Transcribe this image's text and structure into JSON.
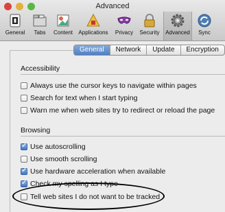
{
  "window": {
    "title": "Advanced",
    "traffic_colors": [
      "#d9453b",
      "#e5b13a",
      "#5bb744"
    ]
  },
  "toolbar": {
    "items": [
      {
        "label": "General",
        "icon": "general-icon"
      },
      {
        "label": "Tabs",
        "icon": "tabs-icon"
      },
      {
        "label": "Content",
        "icon": "content-icon"
      },
      {
        "label": "Applications",
        "icon": "applications-icon"
      },
      {
        "label": "Privacy",
        "icon": "privacy-icon"
      },
      {
        "label": "Security",
        "icon": "security-icon"
      },
      {
        "label": "Advanced",
        "icon": "gear-icon",
        "selected": true
      },
      {
        "label": "Sync",
        "icon": "sync-icon"
      }
    ]
  },
  "tabs": {
    "items": [
      {
        "label": "General",
        "active": true
      },
      {
        "label": "Network",
        "active": false
      },
      {
        "label": "Update",
        "active": false
      },
      {
        "label": "Encryption",
        "active": false
      }
    ]
  },
  "accessibility": {
    "title": "Accessibility",
    "options": [
      {
        "label": "Always use the cursor keys to navigate within pages",
        "checked": false
      },
      {
        "label": "Search for text when I start typing",
        "checked": false
      },
      {
        "label": "Warn me when web sites try to redirect or reload the page",
        "checked": false
      }
    ]
  },
  "browsing": {
    "title": "Browsing",
    "options": [
      {
        "label": "Use autoscrolling",
        "checked": true
      },
      {
        "label": "Use smooth scrolling",
        "checked": false
      },
      {
        "label": "Use hardware acceleration when available",
        "checked": true
      },
      {
        "label": "Check my spelling as I type",
        "checked": true
      },
      {
        "label": "Tell web sites I do not want to be tracked",
        "checked": false
      }
    ]
  },
  "colors": {
    "accent": "#4e7fc6",
    "window_bg": "#ececec",
    "highlight_ellipse": "#000000"
  }
}
